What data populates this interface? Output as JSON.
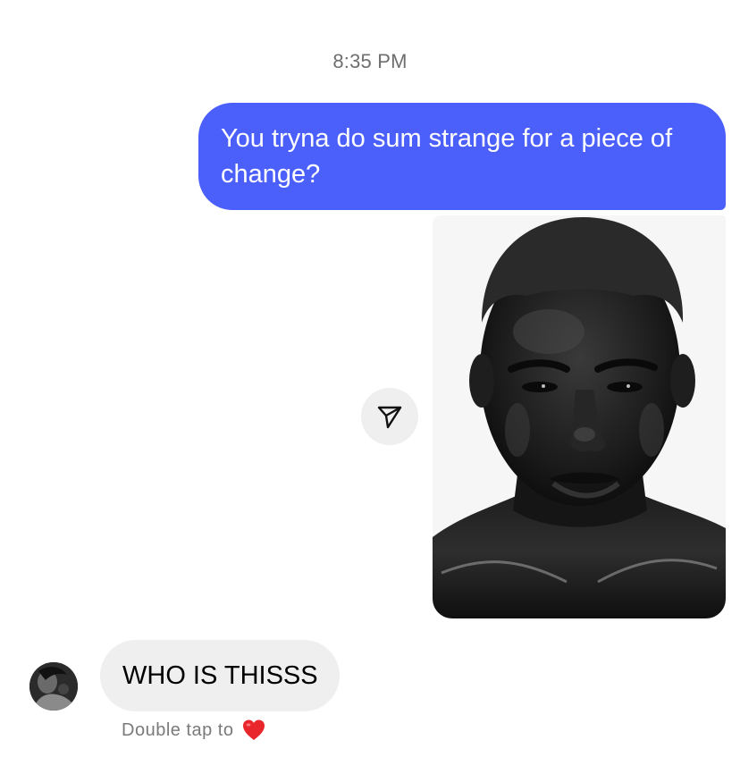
{
  "thread": {
    "timestamp": "8:35 PM",
    "messages": [
      {
        "direction": "outgoing",
        "type": "text",
        "text": "You tryna do sum strange for a piece of change?"
      },
      {
        "direction": "outgoing",
        "type": "image"
      },
      {
        "direction": "incoming",
        "type": "text",
        "text": "WHO IS THISSS"
      }
    ],
    "reaction_hint": {
      "text": "Double tap to",
      "icon": "heart-icon"
    }
  },
  "colors": {
    "outgoing_bubble": "#4b5ffb",
    "incoming_bubble": "#efefef",
    "timestamp_text": "#6e6e6e",
    "heart": "#e8262b"
  },
  "icons": {
    "share": "paper-plane-icon",
    "reaction": "heart-icon"
  }
}
